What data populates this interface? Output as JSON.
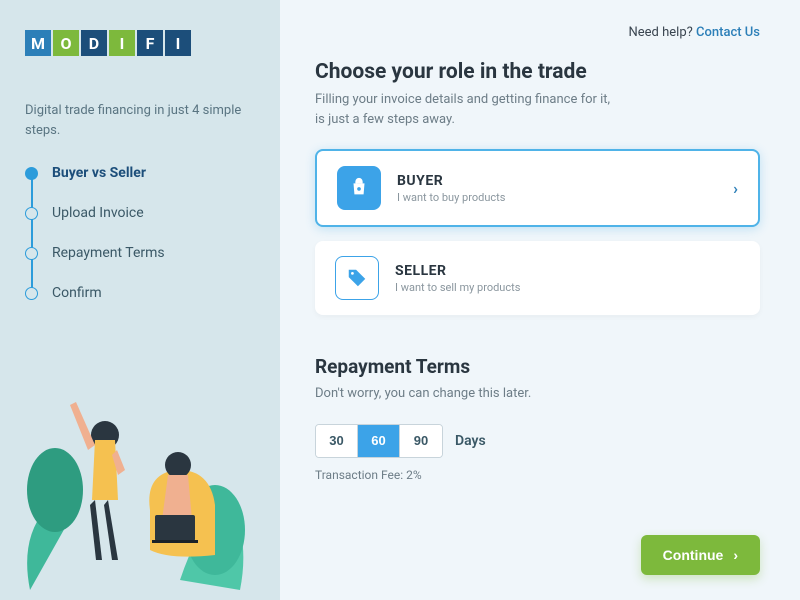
{
  "logo": [
    "M",
    "O",
    "D",
    "I",
    "F",
    "I"
  ],
  "logoColors": [
    "blue",
    "green",
    "navy",
    "green",
    "navy",
    "navy"
  ],
  "sidebar": {
    "subtitle": "Digital trade financing in just 4 simple steps.",
    "steps": [
      {
        "label": "Buyer vs Seller",
        "active": true
      },
      {
        "label": "Upload Invoice",
        "active": false
      },
      {
        "label": "Repayment Terms",
        "active": false
      },
      {
        "label": "Confirm",
        "active": false
      }
    ]
  },
  "help": {
    "prefix": "Need help? ",
    "link": "Contact Us"
  },
  "role": {
    "title": "Choose your role in the trade",
    "desc": "Filling your invoice details and getting finance for it,\nis just a few steps away.",
    "cards": [
      {
        "title": "BUYER",
        "desc": "I want to buy products",
        "selected": true
      },
      {
        "title": "SELLER",
        "desc": "I want to sell my products",
        "selected": false
      }
    ]
  },
  "repayment": {
    "title": "Repayment Terms",
    "desc": "Don't worry, you can change this later.",
    "options": [
      "30",
      "60",
      "90"
    ],
    "selected": "60",
    "daysLabel": "Days",
    "fee": "Transaction Fee: 2%"
  },
  "continue": "Continue"
}
